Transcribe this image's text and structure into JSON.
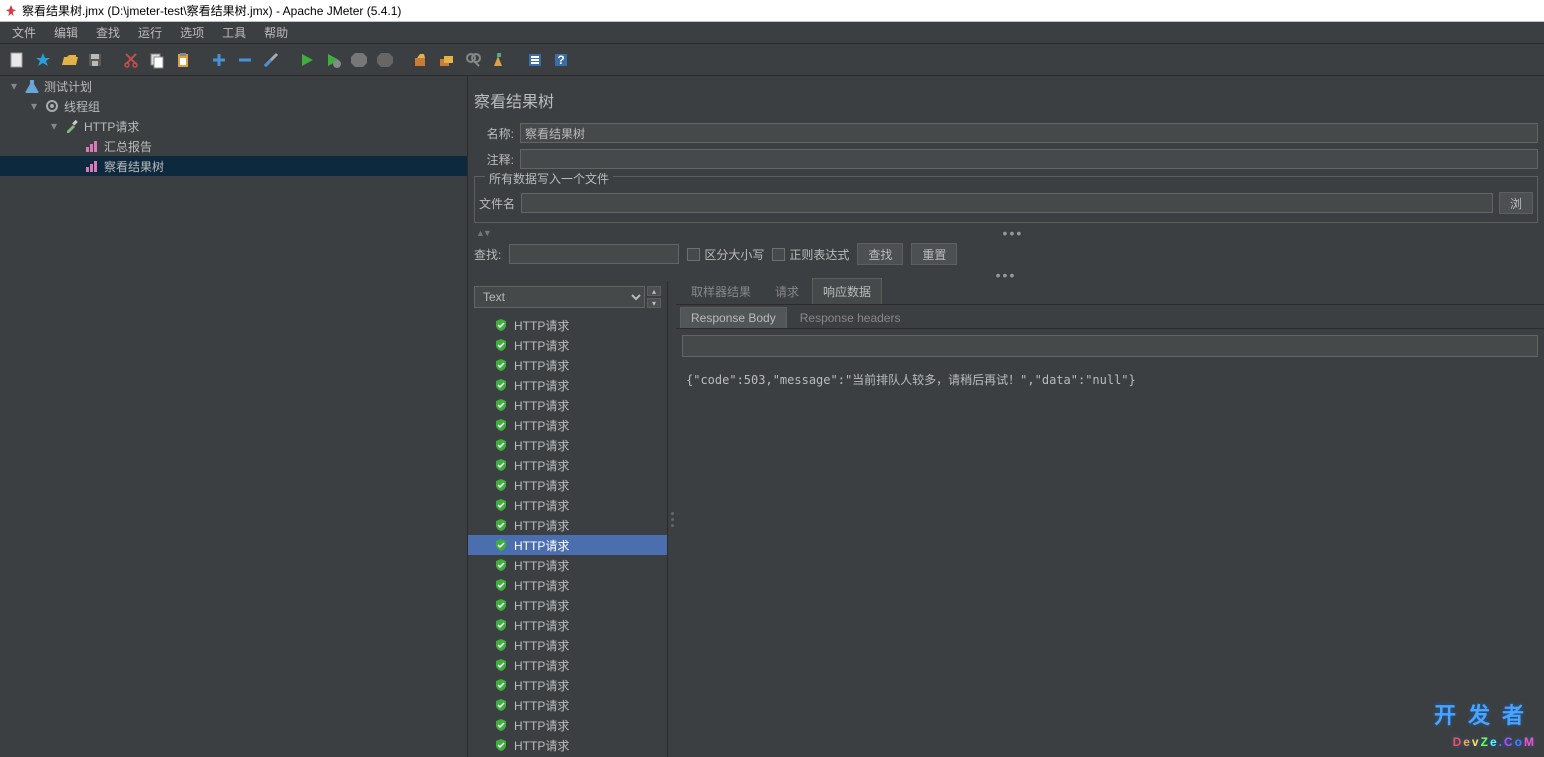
{
  "window": {
    "title": "察看结果树.jmx (D:\\jmeter-test\\察看结果树.jmx) - Apache JMeter (5.4.1)"
  },
  "menu": [
    "文件",
    "编辑",
    "查找",
    "运行",
    "选项",
    "工具",
    "帮助"
  ],
  "tree": {
    "items": [
      {
        "depth": 0,
        "expander": "▾",
        "icon": "flask",
        "label": "测试计划"
      },
      {
        "depth": 1,
        "expander": "▾",
        "icon": "gear",
        "label": "线程组"
      },
      {
        "depth": 2,
        "expander": "▾",
        "icon": "pipette",
        "label": "HTTP请求"
      },
      {
        "depth": 3,
        "expander": "",
        "icon": "chart",
        "label": "汇总报告"
      },
      {
        "depth": 3,
        "expander": "",
        "icon": "chart",
        "label": "察看结果树",
        "selected": true
      }
    ]
  },
  "main": {
    "title": "察看结果树",
    "nameLabel": "名称:",
    "nameValue": "察看结果树",
    "commentLabel": "注释:",
    "commentValue": "",
    "fileLegend": "所有数据写入一个文件",
    "fileLabel": "文件名",
    "fileValue": "",
    "browseBtn": "浏",
    "searchLabel": "查找:",
    "searchValue": "",
    "caseSensitive": "区分大小写",
    "regex": "正则表达式",
    "searchBtn": "查找",
    "resetBtn": "重置",
    "renderCombo": "Text",
    "tabs": [
      "取样器结果",
      "请求",
      "响应数据"
    ],
    "activeTab": 2,
    "subTabs": [
      "Response Body",
      "Response headers"
    ],
    "activeSubTab": 0,
    "responseFilter": "",
    "responseBody": "{\"code\":503,\"message\":\"当前排队人较多，请稍后再试！\",\"data\":\"null\"}"
  },
  "results": {
    "count": 22,
    "selectedIndex": 11,
    "label": "HTTP请求"
  },
  "watermark": {
    "line1": "开发者",
    "line2": "DevZe.CoM"
  }
}
